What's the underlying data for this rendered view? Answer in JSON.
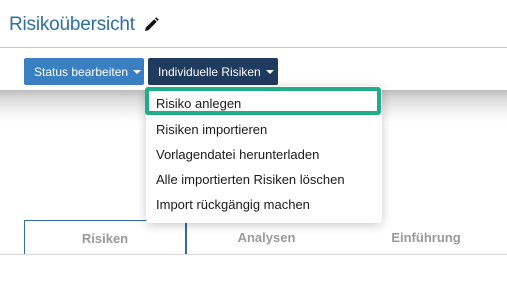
{
  "header": {
    "title": "Risikoübersicht",
    "edit_icon": "pencil-icon"
  },
  "toolbar": {
    "status_label": "Status bearbeiten",
    "individual_label": "Individuelle Risiken",
    "caret_icon": "caret-down-icon"
  },
  "dropdown": {
    "items": [
      {
        "label": "Risiko anlegen",
        "highlighted": true
      },
      {
        "label": "Risiken importieren"
      },
      {
        "label": "Vorlagendatei herunterladen"
      },
      {
        "label": "Alle importierten Risiken löschen"
      },
      {
        "label": "Import rückgängig machen"
      }
    ]
  },
  "tabs": [
    {
      "label": "Risiken",
      "active": true
    },
    {
      "label": "Analysen"
    },
    {
      "label": "Einführung"
    }
  ],
  "colors": {
    "title": "#2f6ea8",
    "status_button": "#3a7fc1",
    "individual_button": "#1f3b5f",
    "highlight": "#1fad8a"
  }
}
